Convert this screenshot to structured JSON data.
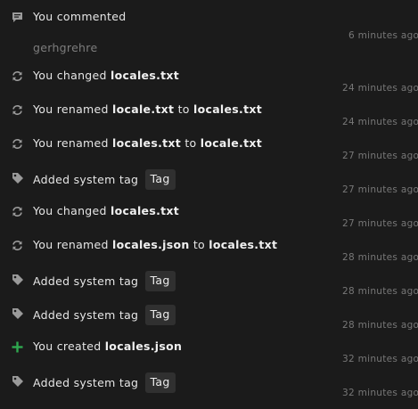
{
  "activity": [
    {
      "type": "comment",
      "icon": "comment-icon",
      "lead": "You commented",
      "body": "gerhgrehre",
      "time": "6 minutes ago"
    },
    {
      "type": "changed",
      "icon": "sync-icon",
      "lead": "You changed",
      "file": "locales.txt",
      "time": "24 minutes ago"
    },
    {
      "type": "renamed",
      "icon": "sync-icon",
      "lead": "You renamed",
      "from": "locale.txt",
      "mid": "to",
      "to": "locales.txt",
      "time": "24 minutes ago"
    },
    {
      "type": "renamed",
      "icon": "sync-icon",
      "lead": "You renamed",
      "from": "locales.txt",
      "mid": "to",
      "to": "locale.txt",
      "time": "27 minutes ago"
    },
    {
      "type": "tag",
      "icon": "tag-icon",
      "lead": "Added system tag",
      "tag": "Tag",
      "time": "27 minutes ago"
    },
    {
      "type": "changed",
      "icon": "sync-icon",
      "lead": "You changed",
      "file": "locales.txt",
      "time": "27 minutes ago"
    },
    {
      "type": "renamed",
      "icon": "sync-icon",
      "lead": "You renamed",
      "from": "locales.json",
      "mid": "to",
      "to": "locales.txt",
      "time": "28 minutes ago"
    },
    {
      "type": "tag",
      "icon": "tag-icon",
      "lead": "Added system tag",
      "tag": "Tag",
      "time": "28 minutes ago"
    },
    {
      "type": "tag",
      "icon": "tag-icon",
      "lead": "Added system tag",
      "tag": "Tag",
      "time": "28 minutes ago"
    },
    {
      "type": "created",
      "icon": "plus-icon",
      "lead": "You created",
      "file": "locales.json",
      "time": "32 minutes ago"
    },
    {
      "type": "tag",
      "icon": "tag-icon",
      "lead": "Added system tag",
      "tag": "Tag",
      "time": "32 minutes ago"
    }
  ],
  "colors": {
    "background": "#1b1b1b",
    "text": "#e6e6e6",
    "muted": "#777777",
    "icon": "#9a9a9a",
    "created_icon": "#2fa84f",
    "tag_bg": "#303030"
  }
}
